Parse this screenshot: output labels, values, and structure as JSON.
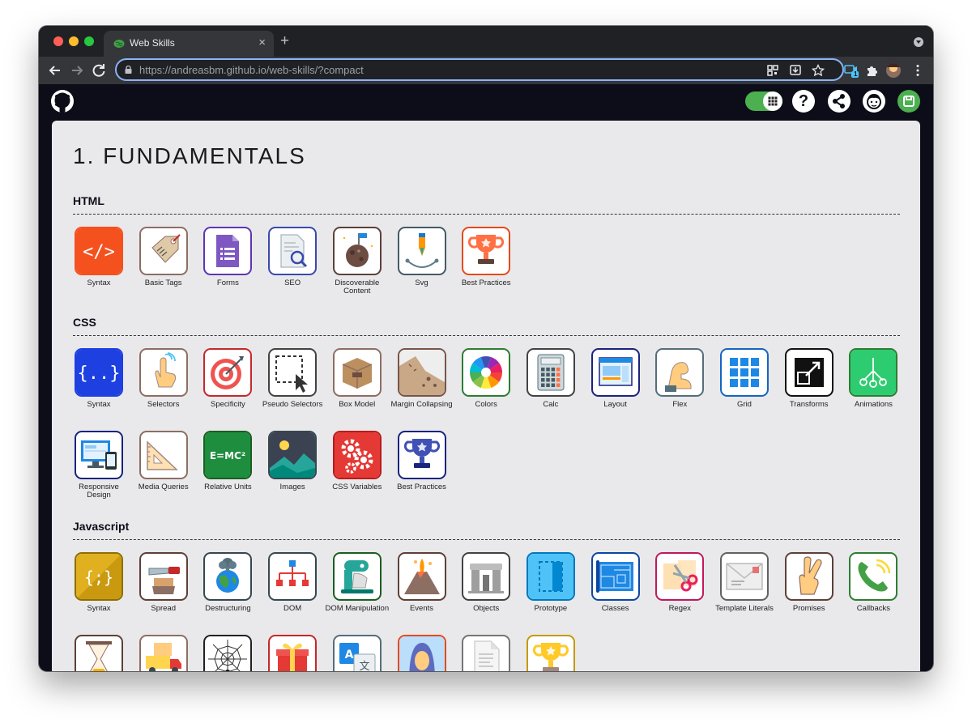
{
  "browser": {
    "tab_title": "Web Skills",
    "tab_close": "×",
    "new_tab": "+",
    "url_host": "https://andreasbm.github.io",
    "url_path": "/web-skills/?compact",
    "extension_badge": "1"
  },
  "site": {
    "header": {
      "help": "?"
    }
  },
  "page": {
    "title": "1. FUNDAMENTALS",
    "sections": [
      {
        "title": "HTML",
        "skills": [
          {
            "label": "Syntax",
            "icon": "code-brackets-icon",
            "color": "#f4511e"
          },
          {
            "label": "Basic Tags",
            "icon": "tag-icon",
            "color": "#8d6e63"
          },
          {
            "label": "Forms",
            "icon": "form-document-icon",
            "color": "#5e35b1"
          },
          {
            "label": "SEO",
            "icon": "magnifier-document-icon",
            "color": "#3949ab"
          },
          {
            "label": "Discoverable Content",
            "icon": "planet-flag-icon",
            "color": "#5d4037"
          },
          {
            "label": "Svg",
            "icon": "pen-tool-icon",
            "color": "#455a64"
          },
          {
            "label": "Best Practices",
            "icon": "trophy-icon",
            "color": "#e64a19"
          }
        ]
      },
      {
        "title": "CSS",
        "skills": [
          {
            "label": "Syntax",
            "icon": "curly-braces-icon",
            "color": "#1e40e0"
          },
          {
            "label": "Selectors",
            "icon": "pointing-hand-icon",
            "color": "#8d6e63"
          },
          {
            "label": "Specificity",
            "icon": "target-icon",
            "color": "#c62828"
          },
          {
            "label": "Pseudo Selectors",
            "icon": "selection-cursor-icon",
            "color": "#424242"
          },
          {
            "label": "Box Model",
            "icon": "box-icon",
            "color": "#8d6e63"
          },
          {
            "label": "Margin Collapsing",
            "icon": "landslide-icon",
            "color": "#795548"
          },
          {
            "label": "Colors",
            "icon": "color-wheel-icon",
            "color": "#2e7d32"
          },
          {
            "label": "Calc",
            "icon": "calculator-icon",
            "color": "#424242"
          },
          {
            "label": "Layout",
            "icon": "browser-layout-icon",
            "color": "#1a237e"
          },
          {
            "label": "Flex",
            "icon": "flexed-arm-icon",
            "color": "#546e7a"
          },
          {
            "label": "Grid",
            "icon": "grid-icon",
            "color": "#1565c0"
          },
          {
            "label": "Transforms",
            "icon": "resize-arrow-icon",
            "color": "#111111"
          },
          {
            "label": "Animations",
            "icon": "animation-nodes-icon",
            "color": "#2e7d32"
          },
          {
            "label": "Responsive Design",
            "icon": "devices-icon",
            "color": "#1a237e"
          },
          {
            "label": "Media Queries",
            "icon": "set-square-icon",
            "color": "#8d6e63"
          },
          {
            "label": "Relative Units",
            "icon": "chalkboard-formula-icon",
            "color": "#1b5e20"
          },
          {
            "label": "Images",
            "icon": "landscape-image-icon",
            "color": "#37474f"
          },
          {
            "label": "CSS Variables",
            "icon": "gears-icon",
            "color": "#b71c1c"
          },
          {
            "label": "Best Practices",
            "icon": "trophy-icon",
            "color": "#1a237e"
          }
        ]
      },
      {
        "title": "Javascript",
        "skills": [
          {
            "label": "Syntax",
            "icon": "semicolon-braces-icon",
            "color": "#8d6e00"
          },
          {
            "label": "Spread",
            "icon": "butter-knife-icon",
            "color": "#5d4037"
          },
          {
            "label": "Destructuring",
            "icon": "exploding-earth-icon",
            "color": "#37474f"
          },
          {
            "label": "DOM",
            "icon": "tree-diagram-icon",
            "color": "#37474f"
          },
          {
            "label": "DOM Manipulation",
            "icon": "mixer-icon",
            "color": "#1b5e20"
          },
          {
            "label": "Events",
            "icon": "volcano-icon",
            "color": "#5d4037"
          },
          {
            "label": "Objects",
            "icon": "stonehenge-icon",
            "color": "#424242"
          },
          {
            "label": "Prototype",
            "icon": "blueprint-frame-icon",
            "color": "#0277bd"
          },
          {
            "label": "Classes",
            "icon": "blueprint-icon",
            "color": "#0d47a1"
          },
          {
            "label": "Regex",
            "icon": "scissors-icon",
            "color": "#c2185b"
          },
          {
            "label": "Template Literals",
            "icon": "envelope-icon",
            "color": "#616161"
          },
          {
            "label": "Promises",
            "icon": "crossed-fingers-icon",
            "color": "#5d4037"
          },
          {
            "label": "Callbacks",
            "icon": "phone-icon",
            "color": "#2e7d32"
          }
        ]
      }
    ],
    "partial_row": [
      {
        "icon": "hourglass-icon",
        "color": "#5d4037"
      },
      {
        "icon": "delivery-truck-icon",
        "color": "#8d6e63"
      },
      {
        "icon": "spider-web-icon",
        "color": "#222222"
      },
      {
        "icon": "gift-icon",
        "color": "#c62828"
      },
      {
        "icon": "translate-icon",
        "color": "#546e7a"
      },
      {
        "icon": "woman-portrait-icon",
        "color": "#e64a19"
      },
      {
        "icon": "document-icon",
        "color": "#757575"
      },
      {
        "icon": "trophy-icon",
        "color": "#c49a00"
      }
    ]
  }
}
